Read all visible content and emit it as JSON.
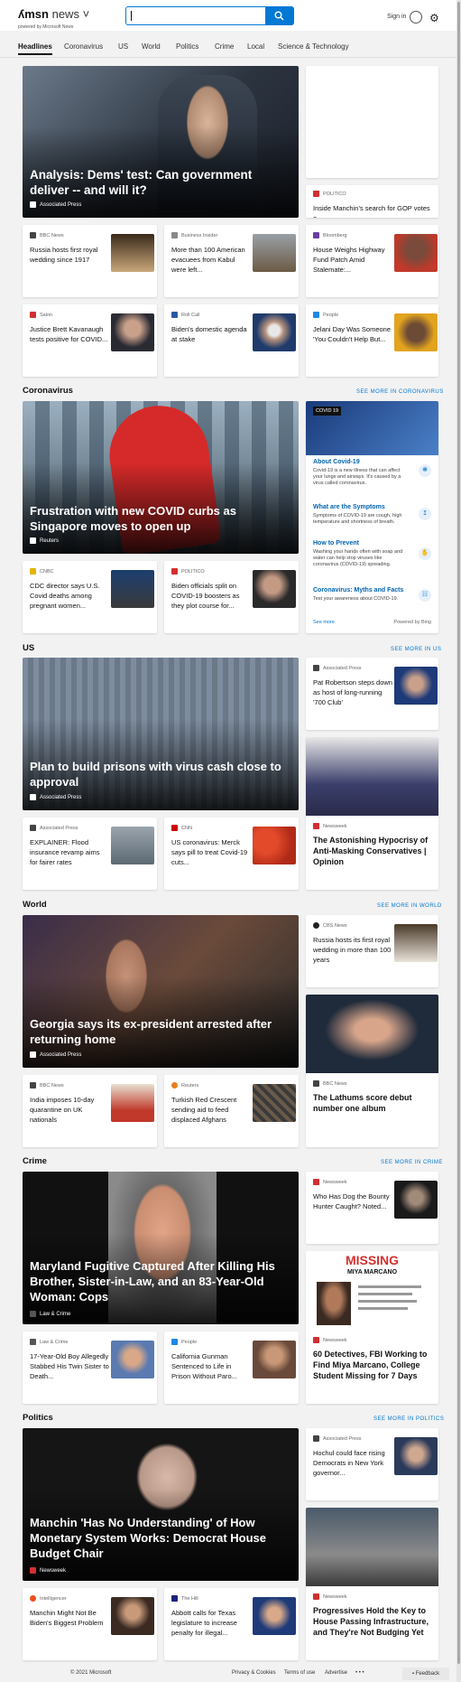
{
  "header": {
    "logo": "msn",
    "logo_sub": "news",
    "powered_by": "powered by Microsoft News",
    "search_placeholder": "",
    "signin": "Sign in"
  },
  "nav": [
    "Headlines",
    "Coronavirus",
    "US",
    "World",
    "Politics",
    "Crime",
    "Local",
    "Science & Technology"
  ],
  "top": {
    "hero": {
      "title": "Analysis: Dems' test: Can government deliver -- and will it?",
      "source": "Associated Press"
    },
    "side1": {
      "source": "POLITICO",
      "title": "Inside Manchin's search for GOP votes o..."
    },
    "row1": [
      {
        "source": "BBC News",
        "title": "Russia hosts first royal wedding since 1917"
      },
      {
        "source": "Business Insider",
        "title": "More than 100 American evacuees from Kabul were left..."
      },
      {
        "source": "Bloomberg",
        "title": "House Weighs Highway Fund Patch Amid Stalemate:..."
      }
    ],
    "row2": [
      {
        "source": "Salon",
        "title": "Justice Brett Kavanaugh tests positive for COVID..."
      },
      {
        "source": "Roll Call",
        "title": "Biden's domestic agenda at stake"
      },
      {
        "source": "People",
        "title": "Jelani Day Was Someone 'You Couldn't Help But..."
      }
    ]
  },
  "coronavirus": {
    "heading": "Coronavirus",
    "more": "SEE MORE IN CORONAVIRUS",
    "hero": {
      "title": "Frustration with new COVID curbs as Singapore moves to open up",
      "source": "Reuters"
    },
    "cards": [
      {
        "source": "CNBC",
        "title": "CDC director says U.S. Covid deaths among pregnant women..."
      },
      {
        "source": "POLITICO",
        "title": "Biden officials split on COVID-19 boosters as they plot course for..."
      }
    ],
    "panel": {
      "badge": "COVID 19",
      "items": [
        {
          "title": "About Covid-19",
          "desc": "Covid-19 is a new illness that can affect your lungs and airways. It's caused by a virus called coronavirus."
        },
        {
          "title": "What are the Symptoms",
          "desc": "Symptoms of COVID-19 are cough, high temperature and shortness of breath."
        },
        {
          "title": "How to Prevent",
          "desc": "Washing your hands often with soap and water can help stop viruses like coronavirus (COVID-19) spreading."
        },
        {
          "title": "Coronavirus: Myths and Facts",
          "desc": "Test your awareness about COVID-19."
        }
      ],
      "see_more": "See more",
      "powered": "Powered by Bing"
    }
  },
  "us": {
    "heading": "US",
    "more": "SEE MORE IN US",
    "hero": {
      "title": "Plan to build prisons with virus cash close to approval",
      "source": "Associated Press"
    },
    "side1": {
      "source": "Associated Press",
      "title": "Pat Robertson steps down as host of long-running '700 Club'"
    },
    "tall": {
      "source": "Newsweek",
      "title": "The Astonishing Hypocrisy of Anti-Masking Conservatives | Opinion"
    },
    "cards": [
      {
        "source": "Associated Press",
        "title": "EXPLAINER: Flood insurance revamp aims for fairer rates"
      },
      {
        "source": "CNN",
        "title": "US coronavirus: Merck says pill to treat Covid-19 cuts..."
      }
    ]
  },
  "world": {
    "heading": "World",
    "more": "SEE MORE IN WORLD",
    "hero": {
      "title": "Georgia says its ex-president arrested after returning home",
      "source": "Associated Press"
    },
    "side1": {
      "source": "CBS News",
      "title": "Russia hosts its first royal wedding in more than 100 years"
    },
    "tall": {
      "source": "BBC News",
      "title": "The Lathums score debut number one album"
    },
    "cards": [
      {
        "source": "BBC News",
        "title": "India imposes 10-day quarantine on UK nationals"
      },
      {
        "source": "Reuters",
        "title": "Turkish Red Crescent sending aid to feed displaced Afghans"
      }
    ]
  },
  "crime": {
    "heading": "Crime",
    "more": "SEE MORE IN CRIME",
    "hero": {
      "title": "Maryland Fugitive Captured After Killing His Brother, Sister-in-Law, and an 83-Year-Old Woman: Cops",
      "source": "Law & Crime"
    },
    "side1": {
      "source": "Newsweek",
      "title": "Who Has Dog the Bounty Hunter Caught? Noted..."
    },
    "tall": {
      "source": "Newsweek",
      "title": "60 Detectives, FBI Working to Find Miya Marcano, College Student Missing for 7 Days",
      "img_title": "MISSING",
      "img_sub": "MIYA MARCANO"
    },
    "cards": [
      {
        "source": "Law & Crime",
        "title": "17-Year-Old Boy Allegedly Stabbed His Twin Sister to Death..."
      },
      {
        "source": "People",
        "title": "California Gunman Sentenced to Life in Prison Without Paro..."
      }
    ]
  },
  "politics": {
    "heading": "Politics",
    "more": "SEE MORE IN POLITICS",
    "hero": {
      "title": "Manchin 'Has No Understanding' of How Monetary System Works: Democrat House Budget Chair",
      "source": "Newsweek"
    },
    "side1": {
      "source": "Associated Press",
      "title": "Hochul could face rising Democrats in New York governor..."
    },
    "tall": {
      "source": "Newsweek",
      "title": "Progressives Hold the Key to House Passing Infrastructure, and They're Not Budging Yet"
    },
    "cards": [
      {
        "source": "Intelligencer",
        "title": "Manchin Might Not Be Biden's Biggest Problem"
      },
      {
        "source": "The Hill",
        "title": "Abbott calls for Texas legislature to increase penalty for illegal..."
      }
    ]
  },
  "footer": {
    "copyright": "© 2021 Microsoft",
    "privacy": "Privacy & Cookies",
    "terms": "Terms of use",
    "advertise": "Advertise",
    "more": "• • •",
    "feedback": "Feedback"
  }
}
